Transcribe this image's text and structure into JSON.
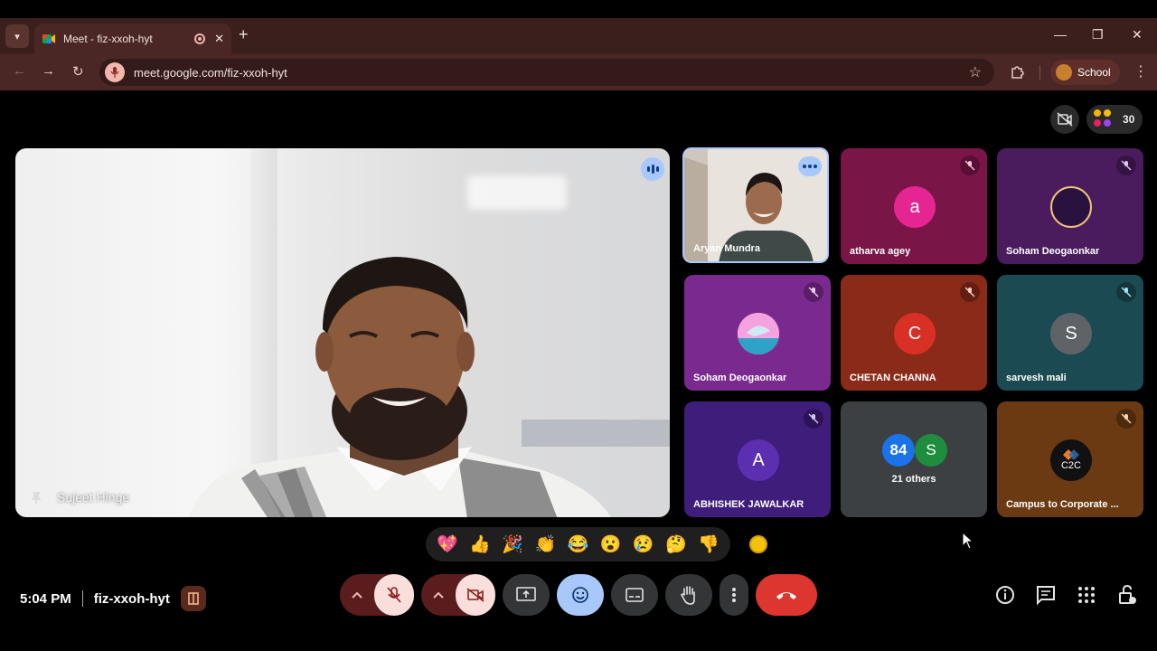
{
  "browser": {
    "tab_title": "Meet - fiz-xxoh-hyt",
    "url": "meet.google.com/fiz-xxoh-hyt",
    "profile_label": "School"
  },
  "meet": {
    "participant_count": "30",
    "main_speaker": "Sujeet Hinge",
    "tiles": [
      {
        "name": "Aryan Mundra",
        "type": "video"
      },
      {
        "name": "atharva agey",
        "type": "avatar",
        "initial": "a",
        "avatar_color": "#e52592",
        "bg": "#7a1548"
      },
      {
        "name": "Soham Deogaonkar",
        "type": "avatar",
        "initial": "",
        "avatar_color": "#2a1240",
        "bg": "#4a1c5e"
      },
      {
        "name": "Soham Deogaonkar",
        "type": "avatar",
        "initial": "",
        "avatar_color": "#e88ad6",
        "bg": "#7a2a8e"
      },
      {
        "name": "CHETAN CHANNA",
        "type": "avatar",
        "initial": "C",
        "avatar_color": "#d93025",
        "bg": "#8a2a18"
      },
      {
        "name": "sarvesh mali",
        "type": "avatar",
        "initial": "S",
        "avatar_color": "#5f6368",
        "bg": "#1c4a52"
      },
      {
        "name": "ABHISHEK JAWALKAR",
        "type": "avatar",
        "initial": "A",
        "avatar_color": "#5b2fb0",
        "bg": "#3f1d7a"
      },
      {
        "name": "21 others",
        "type": "group",
        "count_badge": "84",
        "initial": "S",
        "bg": "#3c4043"
      },
      {
        "name": "Campus to Corporate ...",
        "type": "avatar",
        "initial": "C2C",
        "avatar_color": "#111111",
        "bg": "#6b3a12"
      }
    ],
    "reactions": [
      "💖",
      "👍",
      "🎉",
      "👏",
      "😂",
      "😮",
      "😢",
      "🤔",
      "👎"
    ]
  },
  "bottom_bar": {
    "time": "5:04 PM",
    "meeting_code": "fiz-xxoh-hyt"
  },
  "colors": {
    "accent_blue": "#a8c7fa",
    "end_call_red": "#dc362e",
    "chrome_bg": "#4a2724"
  }
}
